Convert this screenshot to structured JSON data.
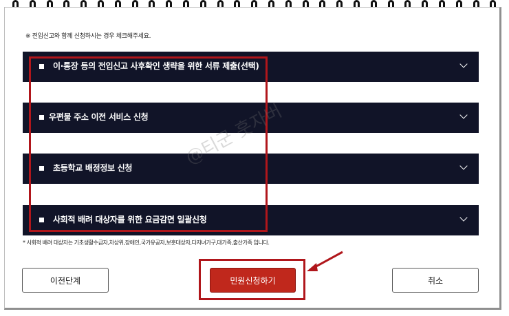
{
  "notice": "※ 전입신고와 함께 신청하시는 경우 체크해주세요.",
  "services": [
    {
      "label": "이·통장 등의 전입신고 사후확인 생략을 위한 서류 제출(선택)"
    },
    {
      "label": "우편물 주소 이전 서비스 신청"
    },
    {
      "label": "초등학교 배정정보 신청"
    },
    {
      "label": "사회적 배려 대상자를 위한 요금감면 일괄신청"
    }
  ],
  "footnote": "* 사회적 배려 대상자는 기초생활수급자,차상위,장애인,국가유공자,보훈대상자,다자녀가구,대가족,출산가족 입니다.",
  "buttons": {
    "prev": "이전단계",
    "apply": "민원신청하기",
    "cancel": "취소"
  },
  "watermark": "@티군 훗자버",
  "colors": {
    "bar": "#111428",
    "accent": "#c0281c",
    "highlight": "#b0161b"
  },
  "icons": {
    "checkbox": "checkbox-square-icon",
    "expand": "chevron-down-icon",
    "ring": "spiral-ring-icon"
  }
}
